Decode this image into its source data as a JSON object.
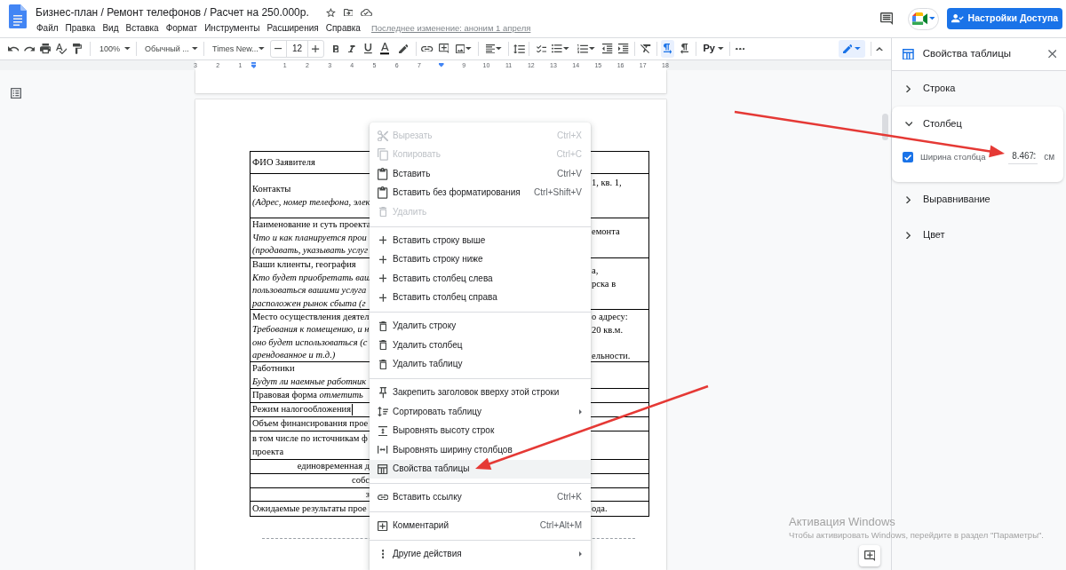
{
  "doc": {
    "title": "Бизнес-план / Ремонт телефонов / Расчет на 250.000р.",
    "menu": [
      "Файл",
      "Правка",
      "Вид",
      "Вставка",
      "Формат",
      "Инструменты",
      "Расширения",
      "Справка"
    ],
    "last_edit": "Последнее изменение: аноним 1 апреля"
  },
  "share_button": "Настройки Доступа",
  "toolbar": {
    "zoom": "100%",
    "style": "Обычный ...",
    "font": "Times New...",
    "font_size": "12",
    "input_tools": "Ру",
    "direction_buttons": [
      {
        "selected": true
      },
      {
        "selected": false
      }
    ]
  },
  "ruler": [
    {
      "kind": "number",
      "label": "3"
    },
    {
      "kind": "number",
      "label": "2"
    },
    {
      "kind": "number",
      "label": "1"
    },
    {
      "kind": "marker"
    },
    {
      "kind": "number",
      "label": "1"
    },
    {
      "kind": "number",
      "label": "2"
    },
    {
      "kind": "number",
      "label": "3"
    },
    {
      "kind": "number",
      "label": "4"
    },
    {
      "kind": "number",
      "label": "5"
    },
    {
      "kind": "number",
      "label": "6"
    },
    {
      "kind": "number",
      "label": "7"
    },
    {
      "kind": "marker"
    },
    {
      "kind": "number",
      "label": "9"
    },
    {
      "kind": "number",
      "label": "10"
    },
    {
      "kind": "number",
      "label": "11"
    },
    {
      "kind": "number",
      "label": "12"
    },
    {
      "kind": "number",
      "label": "13"
    },
    {
      "kind": "number",
      "label": "14"
    },
    {
      "kind": "number",
      "label": "15"
    },
    {
      "kind": "number",
      "label": "16"
    },
    {
      "kind": "number",
      "label": "17"
    },
    {
      "kind": "number",
      "label": "18"
    }
  ],
  "table": {
    "rows": [
      {
        "left": [
          {
            "kind": "label",
            "text": "ФИО Заявителя"
          }
        ]
      },
      {
        "left": [
          {
            "kind": "label",
            "text": "Контакты"
          },
          {
            "kind": "hint",
            "text": "(Адрес, номер телефона, элек"
          }
        ],
        "right": [
          {
            "kind": "label",
            "text": "1, кв. 1,"
          }
        ]
      },
      {
        "left": [
          {
            "kind": "label",
            "text": "Наименование и суть проекта"
          },
          {
            "kind": "hint",
            "text": "Что и как планируется прои"
          },
          {
            "kind": "hint",
            "text": "(продавать, указывать услуг"
          }
        ],
        "right": [
          {
            "kind": "label",
            "text": "емонта"
          }
        ]
      },
      {
        "left": [
          {
            "kind": "label",
            "text": "Ваши клиенты, география"
          },
          {
            "kind": "hint",
            "text": "Кто будет приобретать ваш"
          },
          {
            "kind": "hint",
            "text": "пользоваться вашими услуга"
          },
          {
            "kind": "hint",
            "text": "расположен рынок сбыта (г"
          }
        ],
        "right": [
          {
            "kind": "label",
            "text": "а,"
          },
          {
            "kind": "label",
            "text": "рска в"
          }
        ]
      },
      {
        "left": [
          {
            "kind": "label",
            "text": "Место осуществления деятел"
          },
          {
            "kind": "hint",
            "text": "Требования к помещению, и н"
          },
          {
            "kind": "hint",
            "text": "оно будет использоваться (с"
          },
          {
            "kind": "hint",
            "text": "арендованное и т.д.)"
          }
        ],
        "right": [
          {
            "kind": "label",
            "text": "о адресу:"
          },
          {
            "kind": "label",
            "text": "20 кв.м."
          },
          {
            "kind": "label",
            "text": "ельности."
          }
        ]
      },
      {
        "left": [
          {
            "kind": "label",
            "text": "Работники"
          },
          {
            "kind": "hint",
            "text": "Будут ли наемные работник"
          }
        ]
      },
      {
        "left": [
          {
            "kind": "label",
            "text": "Правовая форма *отметить*"
          }
        ]
      },
      {
        "left": [
          {
            "kind": "label",
            "text": "Режим налогообложения",
            "cursor": true
          }
        ]
      },
      {
        "left": [
          {
            "kind": "label",
            "text": "Объем финансирования прое"
          }
        ]
      },
      {
        "left": [
          {
            "kind": "label",
            "text": "в том числе по источникам ф"
          },
          {
            "kind": "label",
            "text": "проекта"
          }
        ]
      },
      {
        "centered": true,
        "left": [
          {
            "kind": "label",
            "text": "единовременная д"
          }
        ]
      },
      {
        "centered": true,
        "left": [
          {
            "kind": "label",
            "text": "собс"
          }
        ]
      },
      {
        "centered": true,
        "left": [
          {
            "kind": "label",
            "text": "з"
          }
        ]
      },
      {
        "left": [
          {
            "kind": "label",
            "text": "Ожидаемые результаты прое"
          }
        ],
        "right": [
          {
            "kind": "label",
            "text": "ода."
          }
        ]
      }
    ]
  },
  "context_menu": {
    "groups": [
      {
        "items": [
          {
            "label": "Вырезать",
            "shortcut": "Ctrl+X",
            "disabled": true,
            "selected": false,
            "submenu": false
          },
          {
            "label": "Копировать",
            "shortcut": "Ctrl+C",
            "disabled": true,
            "selected": false,
            "submenu": false
          },
          {
            "label": "Вставить",
            "shortcut": "Ctrl+V",
            "disabled": false,
            "selected": false,
            "submenu": false
          },
          {
            "label": "Вставить без форматирования",
            "shortcut": "Ctrl+Shift+V",
            "disabled": false,
            "selected": false,
            "submenu": false
          },
          {
            "label": "Удалить",
            "disabled": true,
            "selected": false,
            "submenu": false
          }
        ]
      },
      {
        "items": [
          {
            "label": "Вставить строку выше",
            "disabled": false,
            "selected": false,
            "submenu": false
          },
          {
            "label": "Вставить строку ниже",
            "disabled": false,
            "selected": false,
            "submenu": false
          },
          {
            "label": "Вставить столбец слева",
            "disabled": false,
            "selected": false,
            "submenu": false
          },
          {
            "label": "Вставить столбец справа",
            "disabled": false,
            "selected": false,
            "submenu": false
          }
        ]
      },
      {
        "items": [
          {
            "label": "Удалить строку",
            "disabled": false,
            "selected": false,
            "submenu": false
          },
          {
            "label": "Удалить столбец",
            "disabled": false,
            "selected": false,
            "submenu": false
          },
          {
            "label": "Удалить таблицу",
            "disabled": false,
            "selected": false,
            "submenu": false
          }
        ]
      },
      {
        "items": [
          {
            "label": "Закрепить заголовок вверху этой строки",
            "disabled": false,
            "selected": false,
            "submenu": false
          },
          {
            "label": "Сортировать таблицу",
            "disabled": false,
            "selected": false,
            "submenu": true
          },
          {
            "label": "Выровнять высоту строк",
            "disabled": false,
            "selected": false,
            "submenu": false
          },
          {
            "label": "Выровнять ширину столбцов",
            "disabled": false,
            "selected": false,
            "submenu": false
          },
          {
            "label": "Свойства таблицы",
            "disabled": false,
            "selected": true,
            "submenu": false
          }
        ]
      },
      {
        "items": [
          {
            "label": "Вставить ссылку",
            "shortcut": "Ctrl+K",
            "disabled": false,
            "selected": false,
            "submenu": false
          }
        ]
      },
      {
        "items": [
          {
            "label": "Комментарий",
            "shortcut": "Ctrl+Alt+M",
            "disabled": false,
            "selected": false,
            "submenu": false
          }
        ]
      },
      {
        "items": [
          {
            "label": "Другие действия",
            "disabled": false,
            "selected": false,
            "submenu": true
          }
        ]
      }
    ]
  },
  "side_panel": {
    "title": "Свойства таблицы",
    "sections": [
      {
        "title": "Строка",
        "expanded": false
      },
      {
        "title": "Столбец",
        "expanded": true,
        "fields": [
          {
            "label": "Ширина столбца",
            "checked": true,
            "value": "8.467",
            "unit": "см"
          }
        ]
      },
      {
        "title": "Выравнивание",
        "expanded": false
      },
      {
        "title": "Цвет",
        "expanded": false
      }
    ]
  },
  "os_notice": {
    "title": "Активация Windows",
    "text": "Чтобы активировать Windows, перейдите в раздел \"Параметры\"."
  }
}
